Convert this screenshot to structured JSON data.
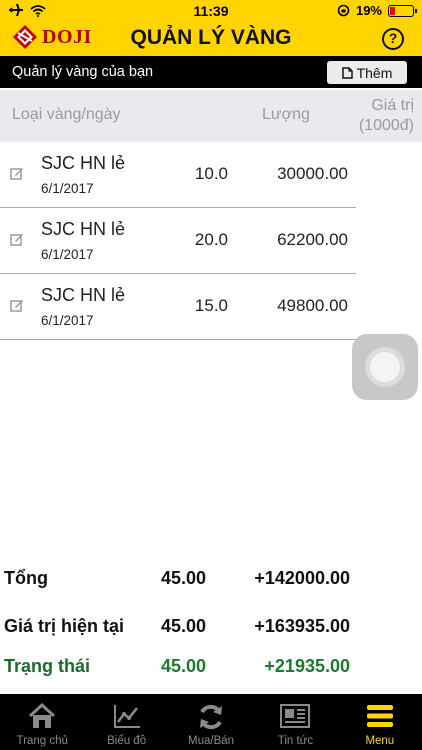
{
  "status_bar": {
    "time": "11:39",
    "battery": "19%",
    "battery_level": 0.19
  },
  "header": {
    "logo_text": "DOJI",
    "title": "QUẢN LÝ VÀNG",
    "help_label": "?"
  },
  "subheader": {
    "caption": "Quản lý vàng của bạn",
    "add_label": "Thêm"
  },
  "columns": {
    "type_date": "Loại vàng/ngày",
    "amount": "Lượng",
    "value_line1": "Giá trị",
    "value_line2": "(1000đ)"
  },
  "rows": [
    {
      "name": "SJC HN lẻ",
      "date": "6/1/2017",
      "qty": "10.0",
      "value": "30000.00"
    },
    {
      "name": "SJC HN lẻ",
      "date": "6/1/2017",
      "qty": "20.0",
      "value": "62200.00"
    },
    {
      "name": "SJC HN lẻ",
      "date": "6/1/2017",
      "qty": "15.0",
      "value": "49800.00"
    }
  ],
  "summary": {
    "total": {
      "label": "Tổng",
      "qty": "45.00",
      "value": "+142000.00"
    },
    "current": {
      "label": "Giá trị hiện tại",
      "qty": "45.00",
      "value": "+163935.00"
    },
    "status": {
      "label": "Trạng thái",
      "qty": "45.00",
      "value": "+21935.00"
    }
  },
  "tabs": [
    {
      "label": "Trang chủ",
      "icon": "home-icon"
    },
    {
      "label": "Biểu đồ",
      "icon": "chart-icon"
    },
    {
      "label": "Mua/Bán",
      "icon": "refresh-icon"
    },
    {
      "label": "Tin tức",
      "icon": "news-icon"
    },
    {
      "label": "Menu",
      "icon": "menu-icon"
    }
  ],
  "colors": {
    "brand_yellow": "#ffd400",
    "positive_green": "#1a7a30",
    "logo_red": "#c00000"
  }
}
